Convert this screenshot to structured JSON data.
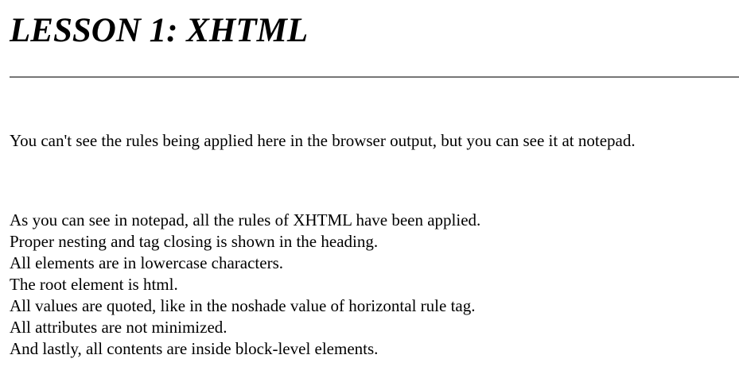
{
  "heading": "LESSON 1: XHTML",
  "intro": "You can't see the rules being applied here in the browser output, but you can see it at notepad.",
  "notes": [
    "As you can see in notepad, all the rules of XHTML have been applied.",
    "Proper nesting and tag closing is shown in the heading.",
    "All elements are in lowercase characters.",
    "The root element is html.",
    "All values are quoted, like in the noshade value of horizontal rule tag.",
    "All attributes are not minimized.",
    "And lastly, all contents are inside block-level elements."
  ]
}
